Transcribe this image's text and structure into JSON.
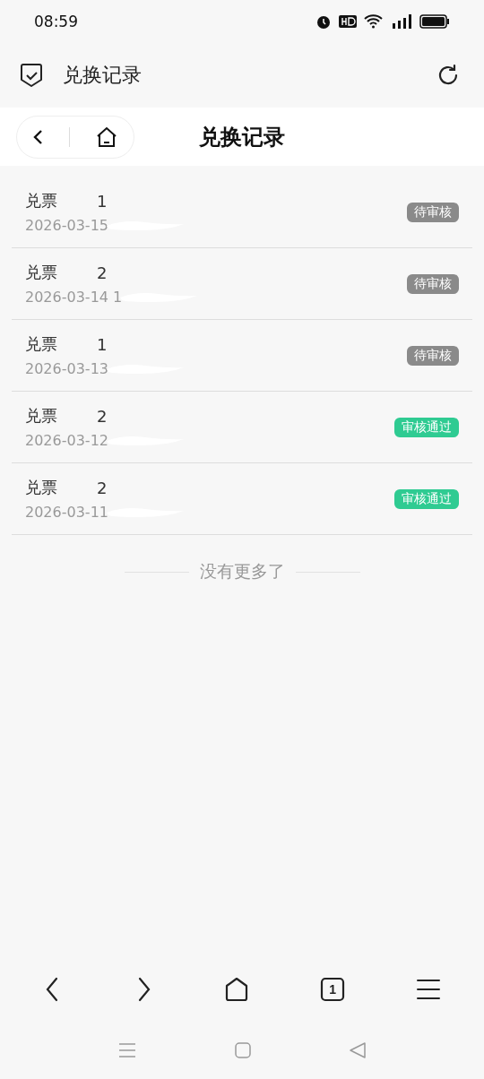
{
  "status_bar": {
    "time": "08:59"
  },
  "app_bar": {
    "title": "兑换记录"
  },
  "page_header": {
    "title": "兑换记录"
  },
  "records": [
    {
      "name": "兑票",
      "quantity": "1",
      "date": "2026-03-15",
      "redacted": true,
      "status": {
        "kind": "pending",
        "label": "待审核"
      }
    },
    {
      "name": "兑票",
      "quantity": "2",
      "date": "2026-03-14 1",
      "redacted": true,
      "status": {
        "kind": "pending",
        "label": "待审核"
      }
    },
    {
      "name": "兑票",
      "quantity": "1",
      "date": "2026-03-13",
      "redacted": true,
      "status": {
        "kind": "pending",
        "label": "待审核"
      }
    },
    {
      "name": "兑票",
      "quantity": "2",
      "date": "2026-03-12",
      "redacted": true,
      "status": {
        "kind": "approved",
        "label": "审核通过"
      }
    },
    {
      "name": "兑票",
      "quantity": "2",
      "date": "2026-03-11",
      "redacted": true,
      "status": {
        "kind": "approved",
        "label": "审核通过"
      }
    }
  ],
  "end_text": "没有更多了",
  "browser_bar": {
    "tab_count": "1"
  }
}
